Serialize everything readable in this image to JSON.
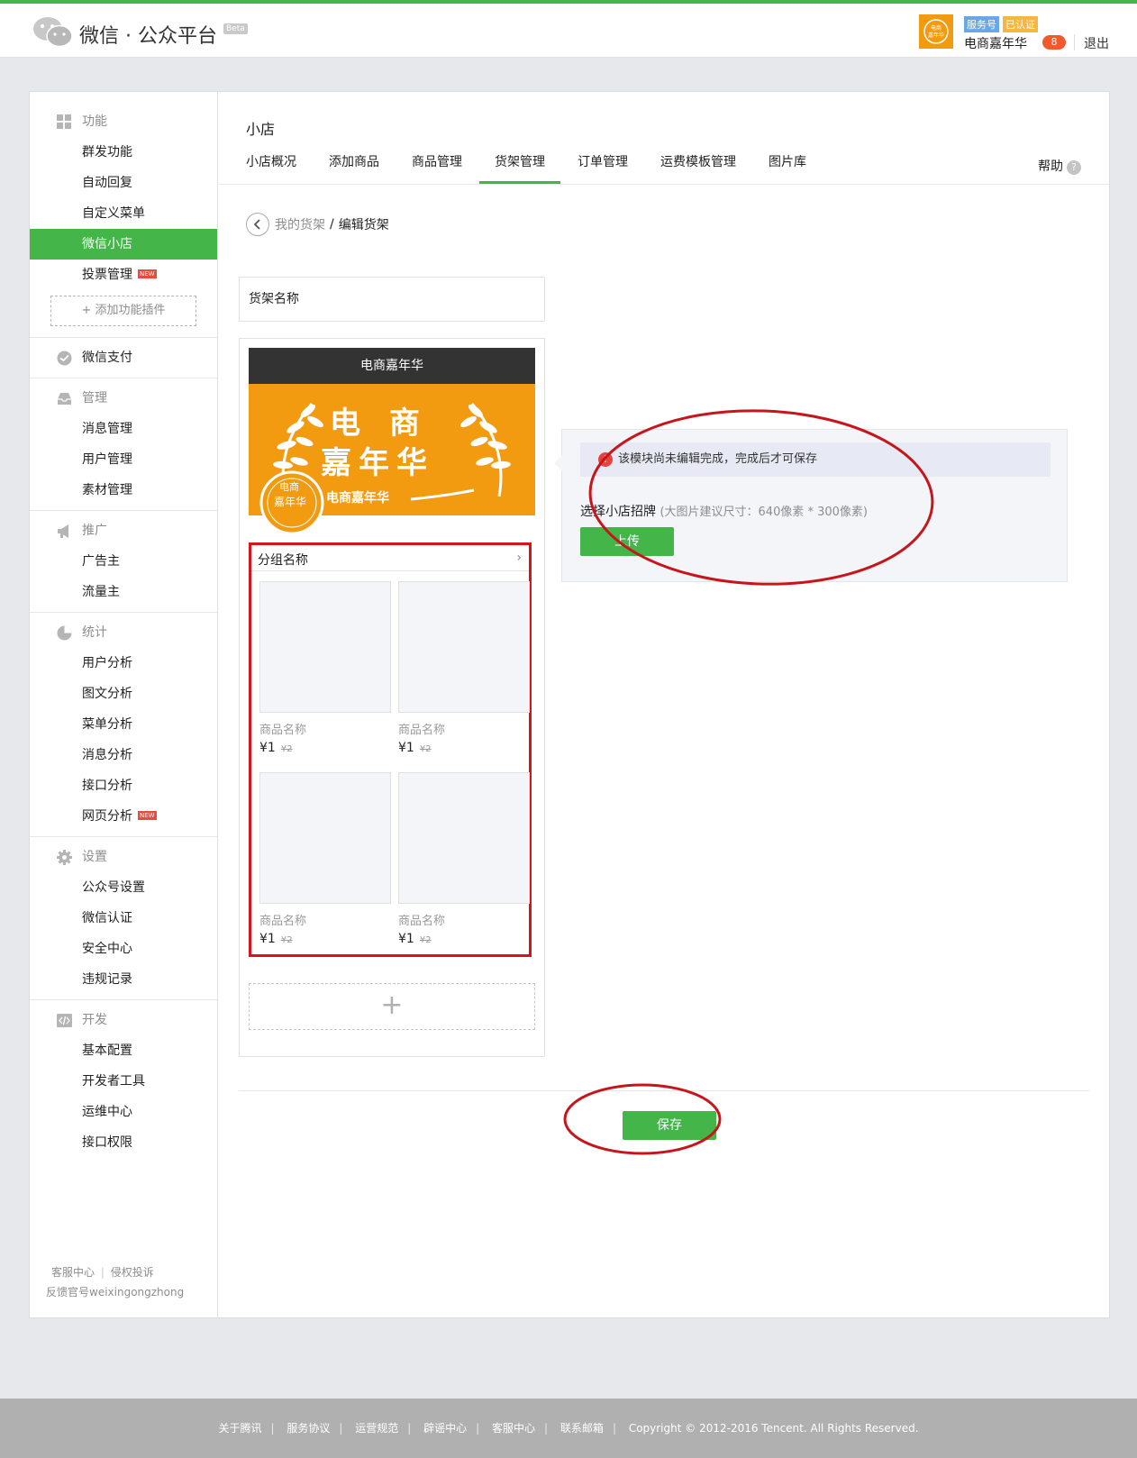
{
  "header": {
    "logo_text": "微信 · 公众平台",
    "beta": "Beta",
    "badge_service": "服务号",
    "badge_verified": "已认证",
    "account_name": "电商嘉年华",
    "notification_count": "8",
    "logout": "退出",
    "accent_color": "#44b549"
  },
  "sidebar": {
    "groups": [
      {
        "title": "功能",
        "icon": "grid-icon",
        "items": [
          "群发功能",
          "自动回复",
          "自定义菜单",
          "微信小店",
          "投票管理"
        ],
        "active": "微信小店",
        "new": [
          "投票管理"
        ]
      },
      {
        "title": "微信支付",
        "icon": "wechat-pay-icon",
        "items": []
      },
      {
        "title": "管理",
        "icon": "tray-icon",
        "items": [
          "消息管理",
          "用户管理",
          "素材管理"
        ]
      },
      {
        "title": "推广",
        "icon": "megaphone-icon",
        "items": [
          "广告主",
          "流量主"
        ]
      },
      {
        "title": "统计",
        "icon": "pie-chart-icon",
        "items": [
          "用户分析",
          "图文分析",
          "菜单分析",
          "消息分析",
          "接口分析",
          "网页分析"
        ],
        "new": [
          "网页分析"
        ]
      },
      {
        "title": "设置",
        "icon": "gear-icon",
        "items": [
          "公众号设置",
          "微信认证",
          "安全中心",
          "违规记录"
        ]
      },
      {
        "title": "开发",
        "icon": "code-icon",
        "items": [
          "基本配置",
          "开发者工具",
          "运维中心",
          "接口权限"
        ]
      }
    ],
    "add_plugin": "添加功能插件",
    "new_label": "NEW",
    "footer_service": "客服中心",
    "footer_complaint": "侵权投诉",
    "footer_feedback": "反馈官号weixingongzhong"
  },
  "main": {
    "title": "小店",
    "tabs": [
      "小店概况",
      "添加商品",
      "商品管理",
      "货架管理",
      "订单管理",
      "运费模板管理",
      "图片库"
    ],
    "active_tab": "货架管理",
    "help": "帮助",
    "breadcrumb_parent": "我的货架",
    "breadcrumb_current": "编辑货架",
    "shelf_name_placeholder": "货架名称",
    "preview": {
      "header_title": "电商嘉年华",
      "banner_title_line1": "电 商",
      "banner_title_line2": "嘉年华",
      "banner_subtitle": "电商嘉年华",
      "seal_line1": "电商",
      "seal_line2": "嘉年华",
      "group_title": "分组名称",
      "products": [
        {
          "name": "商品名称",
          "price": "¥1",
          "old_price": "¥2"
        },
        {
          "name": "商品名称",
          "price": "¥1",
          "old_price": "¥2"
        },
        {
          "name": "商品名称",
          "price": "¥1",
          "old_price": "¥2"
        },
        {
          "name": "商品名称",
          "price": "¥1",
          "old_price": "¥2"
        }
      ],
      "add_symbol": "+"
    },
    "editor": {
      "warning": "该模块尚未编辑完成，完成后才可保存",
      "pick_label": "选择小店招牌",
      "pick_hint": "(大图片建议尺寸：640像素 * 300像素)",
      "upload": "上传"
    },
    "save": "保存"
  },
  "footer": {
    "links": [
      "关于腾讯",
      "服务协议",
      "运营规范",
      "辟谣中心",
      "客服中心",
      "联系邮箱"
    ],
    "copyright": "Copyright © 2012-2016 Tencent. All Rights Reserved."
  }
}
